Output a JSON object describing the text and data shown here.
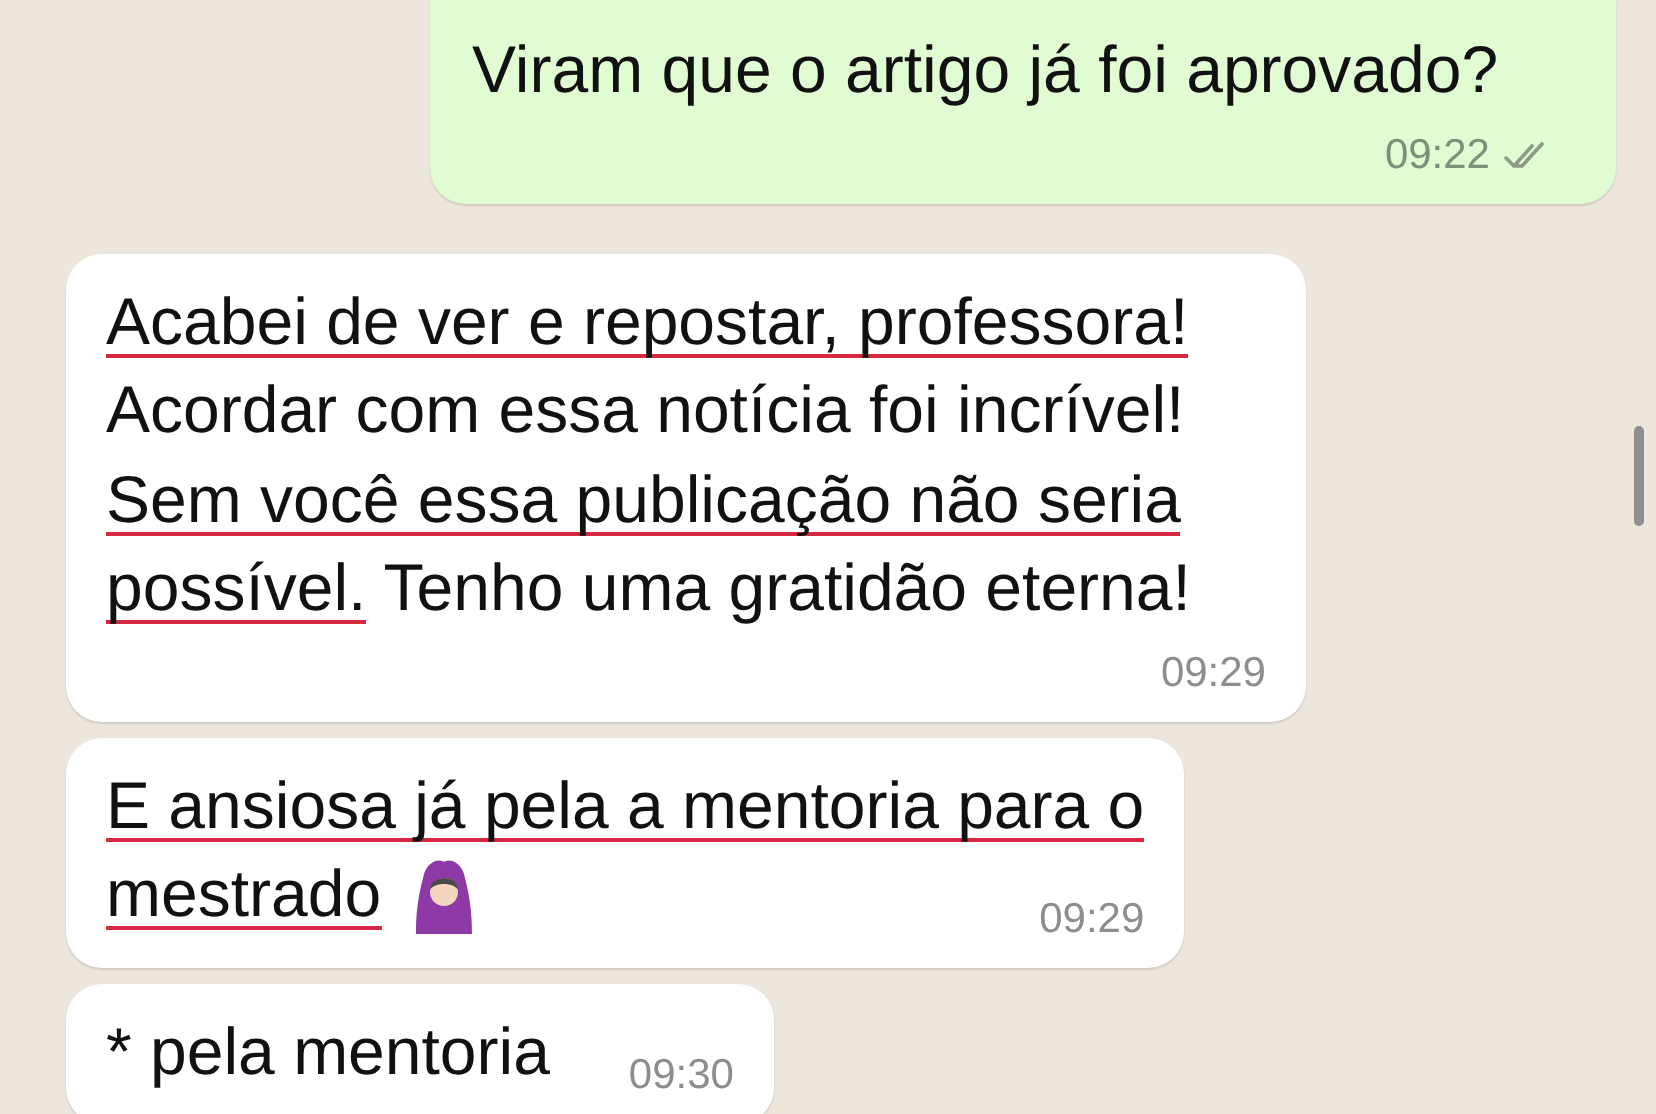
{
  "messages": [
    {
      "kind": "outgoing",
      "lines": [
        [
          {
            "text": "Viram que o artigo já foi aprovado?",
            "underlined": false
          }
        ]
      ],
      "time": "09:22",
      "read": false
    },
    {
      "kind": "incoming",
      "lines": [
        [
          {
            "text": "Acabei de ver e repostar, professora!",
            "underlined": true
          }
        ],
        [
          {
            "text": "Acordar com essa notícia foi incrível!",
            "underlined": false
          }
        ],
        [
          {
            "text": "Sem você essa publicação não seria",
            "underlined": true
          }
        ],
        [
          {
            "text": "possível.",
            "underlined": true
          },
          {
            "text": " Tenho uma gratidão eterna!",
            "underlined": false
          }
        ]
      ],
      "time": "09:29"
    },
    {
      "kind": "incoming",
      "lines": [
        [
          {
            "text": "E ansiosa já pela a mentoria para o",
            "underlined": true
          }
        ],
        [
          {
            "text": "mestrado",
            "underlined": true
          }
        ]
      ],
      "has_emoji": true,
      "time": "09:29"
    },
    {
      "kind": "incoming",
      "lines": [
        [
          {
            "text": "* pela mentoria",
            "underlined": false
          }
        ]
      ],
      "time": "09:30"
    }
  ]
}
